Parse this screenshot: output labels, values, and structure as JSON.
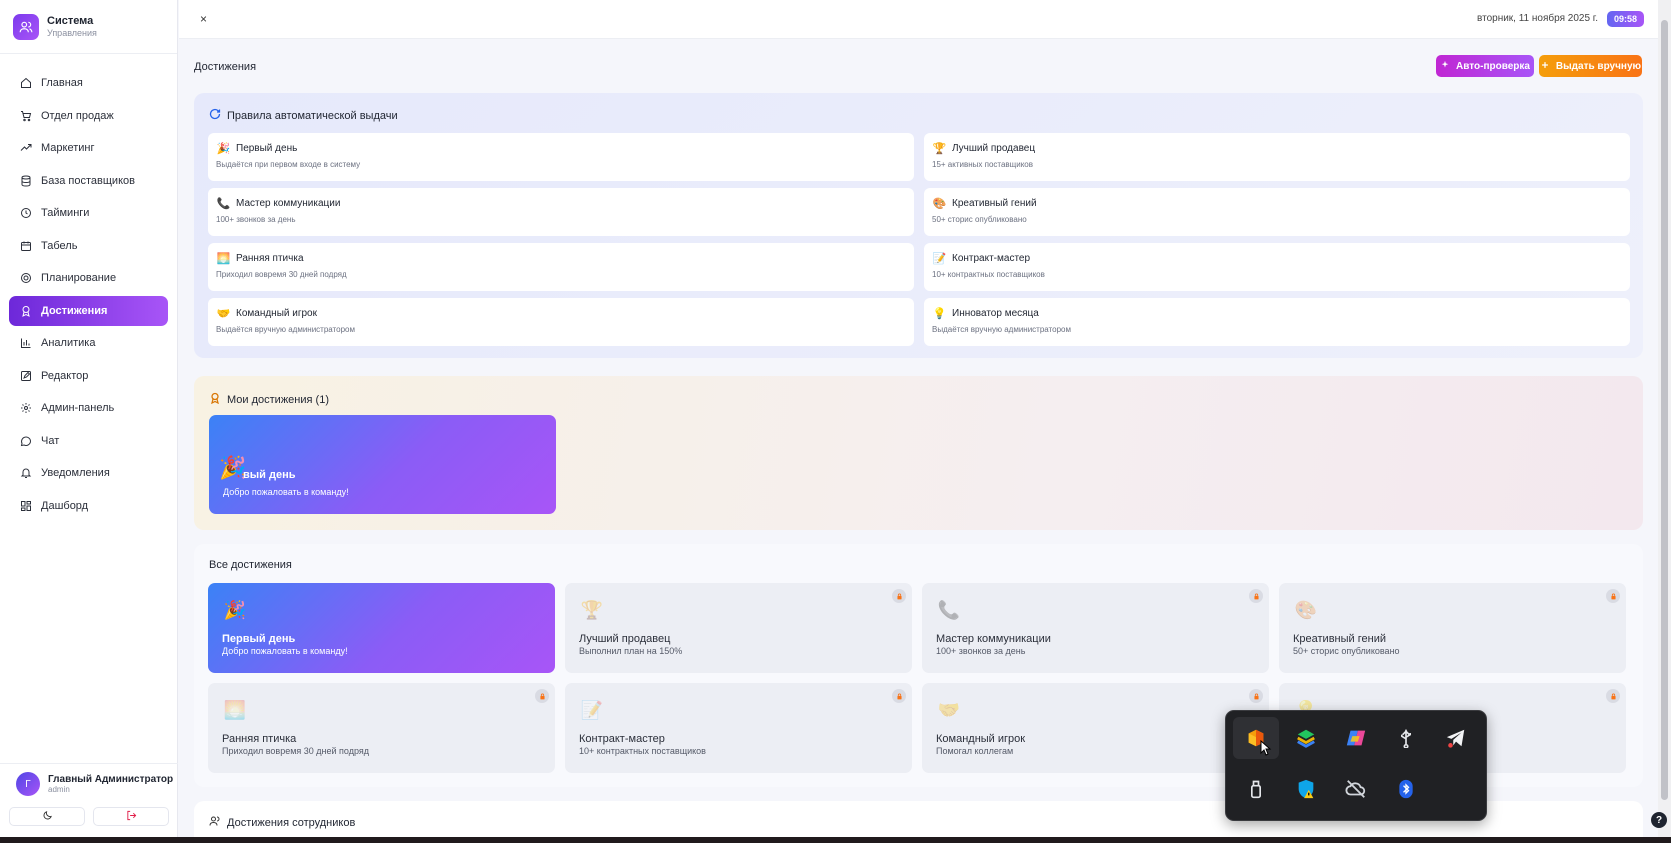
{
  "brand": {
    "title": "Система",
    "subtitle": "Управления"
  },
  "sidebar": {
    "items": [
      {
        "label": "Главная",
        "icon": "home-icon"
      },
      {
        "label": "Отдел продаж",
        "icon": "cart-icon"
      },
      {
        "label": "Маркетинг",
        "icon": "trend-icon"
      },
      {
        "label": "База поставщиков",
        "icon": "database-icon"
      },
      {
        "label": "Тайминги",
        "icon": "clock-icon"
      },
      {
        "label": "Табель",
        "icon": "calendar-icon"
      },
      {
        "label": "Планирование",
        "icon": "target-icon"
      },
      {
        "label": "Достижения",
        "icon": "award-icon",
        "active": true
      },
      {
        "label": "Аналитика",
        "icon": "bar-chart-icon"
      },
      {
        "label": "Редактор",
        "icon": "edit-icon"
      },
      {
        "label": "Админ-панель",
        "icon": "gear-icon"
      },
      {
        "label": "Чат",
        "icon": "chat-icon"
      },
      {
        "label": "Уведомления",
        "icon": "bell-icon"
      },
      {
        "label": "Дашборд",
        "icon": "grid-icon"
      }
    ]
  },
  "user": {
    "initial": "Г",
    "name": "Главный Администратор",
    "role": "admin"
  },
  "topbar": {
    "close": "×",
    "date": "вторник, 11 ноября 2025 г.",
    "time": "09:58"
  },
  "page": {
    "title": "Достижения",
    "auto_check": "Авто-проверка",
    "manual_award": "Выдать вручную"
  },
  "rules": {
    "title": "Правила автоматической выдачи",
    "items": [
      {
        "name": "Первый день",
        "desc": "Выдаётся при первом входе в систему",
        "emoji": "🎉"
      },
      {
        "name": "Лучший продавец",
        "desc": "15+ активных поставщиков",
        "emoji": "🏆"
      },
      {
        "name": "Мастер коммуникации",
        "desc": "100+ звонков за день",
        "emoji": "📞"
      },
      {
        "name": "Креативный гений",
        "desc": "50+ сторис опубликовано",
        "emoji": "🎨"
      },
      {
        "name": "Ранняя птичка",
        "desc": "Приходил вовремя 30 дней подряд",
        "emoji": "🌅"
      },
      {
        "name": "Контракт-мастер",
        "desc": "10+ контрактных поставщиков",
        "emoji": "📝"
      },
      {
        "name": "Командный игрок",
        "desc": "Выдаётся вручную администратором",
        "emoji": "🤝"
      },
      {
        "name": "Инноватор месяца",
        "desc": "Выдаётся вручную администратором",
        "emoji": "💡"
      }
    ]
  },
  "mine": {
    "title": "Мои достижения (1)",
    "card": {
      "name": "вый день",
      "desc": "Добро пожаловать в команду!",
      "emoji": "🎉"
    }
  },
  "all": {
    "title": "Все достижения",
    "items": [
      {
        "name": "Первый день",
        "desc": "Добро пожаловать в команду!",
        "emoji": "🎉",
        "unlocked": true
      },
      {
        "name": "Лучший продавец",
        "desc": "Выполнил план на 150%",
        "emoji": "🏆",
        "unlocked": false
      },
      {
        "name": "Мастер коммуникации",
        "desc": "100+ звонков за день",
        "emoji": "📞",
        "unlocked": false
      },
      {
        "name": "Креативный гений",
        "desc": "50+ сторис опубликовано",
        "emoji": "🎨",
        "unlocked": false
      },
      {
        "name": "Ранняя птичка",
        "desc": "Приходил вовремя 30 дней подряд",
        "emoji": "🌅",
        "unlocked": false
      },
      {
        "name": "Контракт-мастер",
        "desc": "10+ контрактных поставщиков",
        "emoji": "📝",
        "unlocked": false
      },
      {
        "name": "Командный игрок",
        "desc": "Помогал коллегам",
        "emoji": "🤝",
        "unlocked": false
      },
      {
        "name": "",
        "desc": "",
        "emoji": "💡",
        "unlocked": false
      }
    ]
  },
  "employees": {
    "title": "Достижения сотрудников"
  },
  "tray": {
    "icons": [
      "office-app-icon",
      "bluestacks-icon",
      "copilot-icon",
      "usb-icon",
      "telegram-icon",
      "usb-drive-icon",
      "defender-warning-icon",
      "cloud-offline-icon",
      "bluetooth-icon"
    ]
  },
  "help": "?"
}
